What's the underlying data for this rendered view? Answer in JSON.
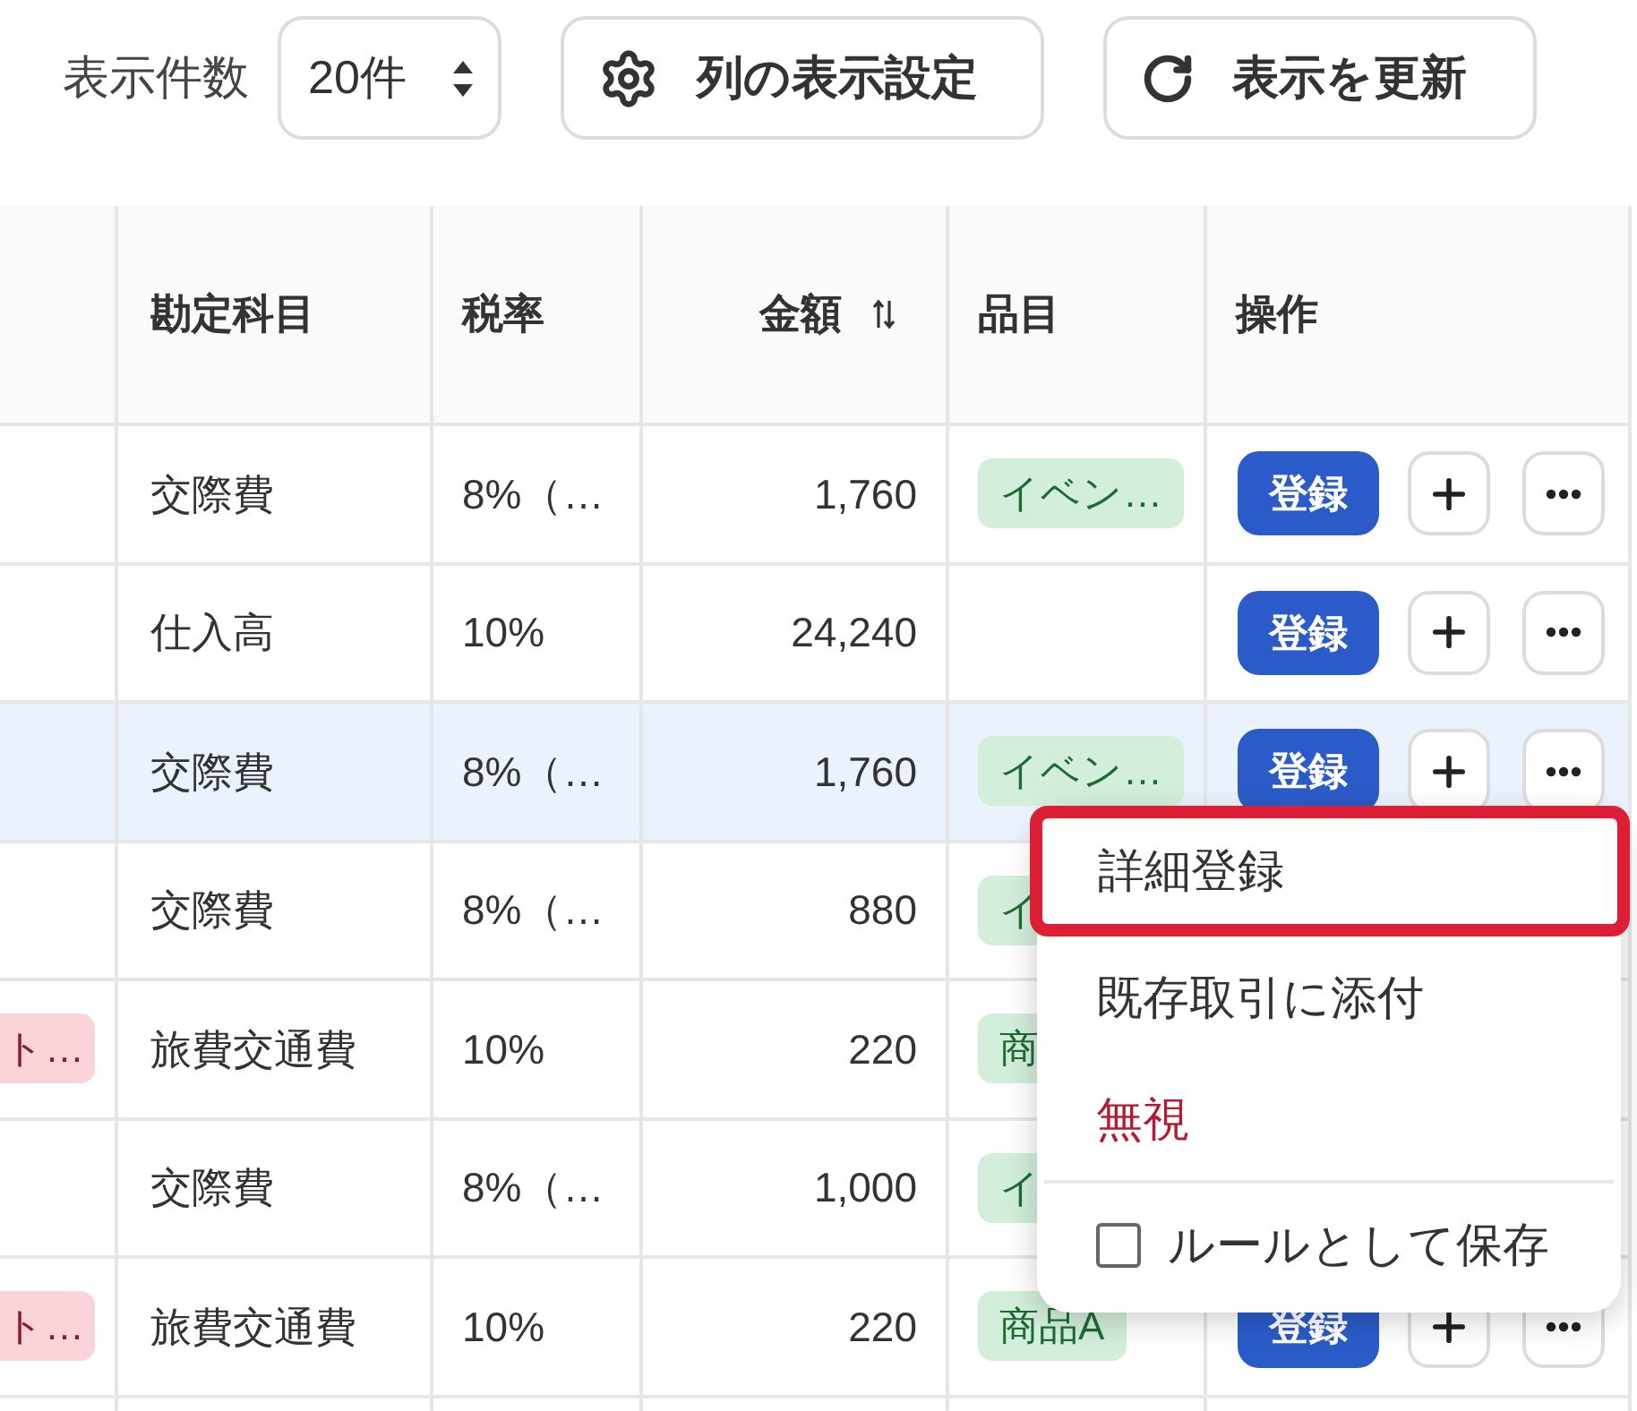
{
  "toolbar": {
    "page_size_label": "表示件数",
    "page_size_select": {
      "value": "20件"
    },
    "buttons": [
      {
        "kind": "columns",
        "label": "列の表示設定"
      },
      {
        "kind": "refresh",
        "label": "表示を更新"
      }
    ]
  },
  "table": {
    "columns": [
      {
        "label": "勘定科目",
        "sortable": false
      },
      {
        "label": "税率",
        "sortable": false
      },
      {
        "label": "金額",
        "sortable": true
      },
      {
        "label": "品目",
        "sortable": false
      },
      {
        "label": "操作",
        "sortable": false
      }
    ],
    "rows": [
      {
        "selected": false,
        "account": "交際費",
        "tax_rate": "8%（…",
        "amount": "1,760",
        "item_tag": "イベン…",
        "action": "登録"
      },
      {
        "selected": false,
        "account": "仕入高",
        "tax_rate": "10%",
        "amount": "24,240",
        "action": "登録"
      },
      {
        "selected": true,
        "account": "交際費",
        "tax_rate": "8%（…",
        "amount": "1,760",
        "item_tag": "イベン…",
        "action": "登録"
      },
      {
        "selected": false,
        "account": "交際費",
        "tax_rate": "8%（…",
        "amount": "880",
        "item_tag": "イ"
      },
      {
        "selected": false,
        "column_1_tag": "ト…",
        "account": "旅費交通費",
        "tax_rate": "10%",
        "amount": "220",
        "item_tag": "商"
      },
      {
        "selected": false,
        "account": "交際費",
        "tax_rate": "8%（…",
        "amount": "1,000",
        "item_tag": "イ"
      },
      {
        "selected": false,
        "column_1_tag": "ト…",
        "account": "旅費交通費",
        "tax_rate": "10%",
        "amount": "220",
        "item_tag": "商品A",
        "action": "登録"
      }
    ]
  },
  "row_menu": {
    "items": [
      {
        "kind": "action",
        "label": "詳細登録",
        "highlighted": true
      },
      {
        "kind": "action",
        "label": "既存取引に添付",
        "highlighted": false
      },
      {
        "kind": "danger",
        "label": "無視",
        "highlighted": false
      },
      {
        "kind": "checkbox",
        "label": "ルールとして保存",
        "checked": false,
        "highlighted": false
      }
    ]
  }
}
